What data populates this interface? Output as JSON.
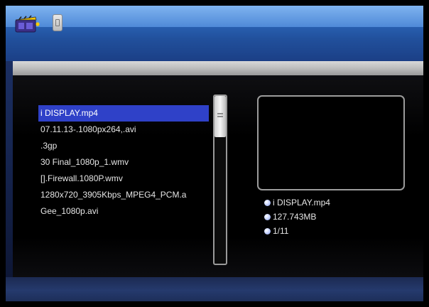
{
  "header": {
    "icons": [
      "movie-clapperboard-icon",
      "usb-drive-icon"
    ]
  },
  "file_list": {
    "items": [
      {
        "label": "i DISPLAY.mp4",
        "selected": true
      },
      {
        "label": "07.11.13-.1080px264,.avi",
        "selected": false
      },
      {
        "label": ".3gp",
        "selected": false
      },
      {
        "label": "30 Final_1080p_1.wmv",
        "selected": false
      },
      {
        "label": "[].Firewall.1080P.wmv",
        "selected": false
      },
      {
        "label": "1280x720_3905Kbps_MPEG4_PCM.a",
        "selected": false
      },
      {
        "label": "Gee_1080p.avi",
        "selected": false
      }
    ]
  },
  "scrollbar": {
    "position_fraction": 0.0
  },
  "info": {
    "filename": "i DISPLAY.mp4",
    "size": "127.743MB",
    "index": "1/11"
  },
  "colors": {
    "header_blue": "#2a64b6",
    "selection_blue": "#2f41c8",
    "panel_bg": "#000000"
  }
}
